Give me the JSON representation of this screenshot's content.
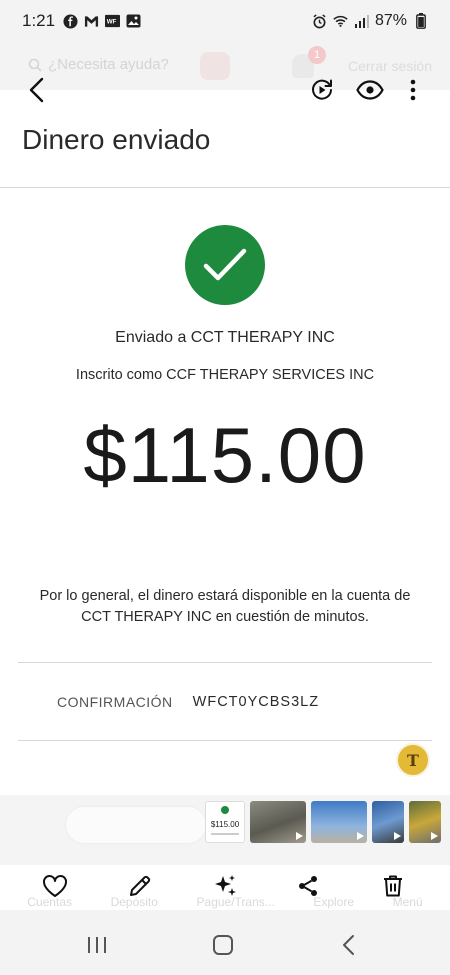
{
  "status_bar": {
    "time": "1:21",
    "battery": "87%",
    "icons": [
      "facebook-icon",
      "gmail-icon",
      "wf-app-icon",
      "gallery-icon",
      "alarm-icon",
      "wifi-icon",
      "signal-icon",
      "battery-icon"
    ]
  },
  "underlay": {
    "search_placeholder": "¿Necesita ayuda?",
    "badge_count": "1",
    "signout_label": "Cerrar sesión",
    "tabs": [
      "Cuentas",
      "Depósito",
      "Pague/Trans...",
      "Explore",
      "Menú"
    ]
  },
  "toolbar": {
    "icons": [
      "back-icon",
      "remix-icon",
      "eye-icon",
      "more-vertical-icon"
    ]
  },
  "screen": {
    "title": "Dinero enviado",
    "sent_to": "Enviado a CCT THERAPY INC",
    "enrolled_as": "Inscrito como CCF THERAPY SERVICES INC",
    "amount": "$115.00",
    "availability": "Por lo general, el dinero estará disponible en la cuenta de CCT THERAPY INC en cuestión de minutos.",
    "confirmation_label": "CONFIRMACIÓN",
    "confirmation_code": "WFCT0YCBS3LZ",
    "fab_letter": "T"
  },
  "thumbnails": {
    "receipt_amount": "$115.00",
    "items": [
      "receipt",
      "car",
      "sky",
      "blue",
      "road"
    ]
  },
  "action_bar": {
    "icons": [
      "heart-icon",
      "edit-icon",
      "ai-sparkle-icon",
      "share-icon",
      "trash-icon"
    ]
  },
  "nav_bar": {
    "icons": [
      "recents-icon",
      "home-icon",
      "back-icon"
    ]
  },
  "colors": {
    "success_green": "#1d8a3e",
    "fab_gold": "#e4b935"
  }
}
